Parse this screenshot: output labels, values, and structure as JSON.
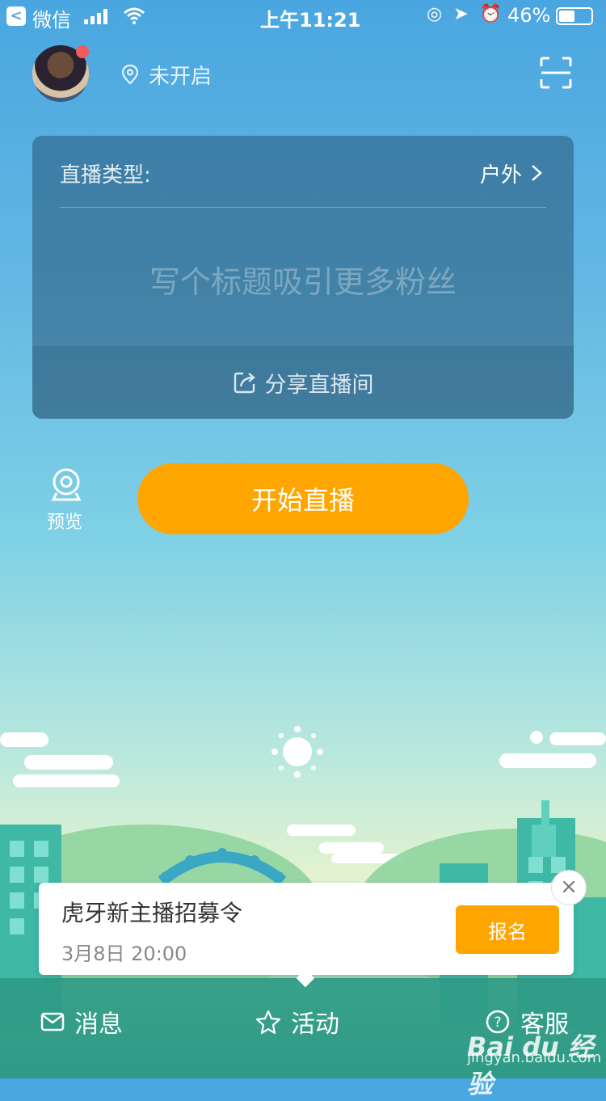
{
  "status_bar": {
    "back": "<",
    "carrier": "微信",
    "time": "上午11:21",
    "battery": "46%"
  },
  "header": {
    "location": "未开启"
  },
  "card": {
    "type_label": "直播类型:",
    "type_value": "户外",
    "title_placeholder": "写个标题吸引更多粉丝",
    "share_label": "分享直播间"
  },
  "actions": {
    "preview_label": "预览",
    "start_label": "开始直播"
  },
  "popup": {
    "title": "虎牙新主播招募令",
    "date": "3月8日 20:00",
    "signup_label": "报名",
    "close_label": "×"
  },
  "nav": {
    "messages": "消息",
    "activity": "活动",
    "service": "客服"
  },
  "watermark": {
    "brand": "Bai du 经验",
    "url": "jingyan.baidu.com"
  },
  "colors": {
    "accent": "#ffa500",
    "notification_dot": "#f45a5a"
  },
  "icons": [
    "back-icon",
    "signal-icon",
    "wifi-icon",
    "battery-icon",
    "location-icon",
    "scan-icon",
    "chevron-right-icon",
    "share-icon",
    "camera-icon",
    "close-icon",
    "mail-icon",
    "star-icon",
    "help-icon",
    "sun-icon"
  ]
}
